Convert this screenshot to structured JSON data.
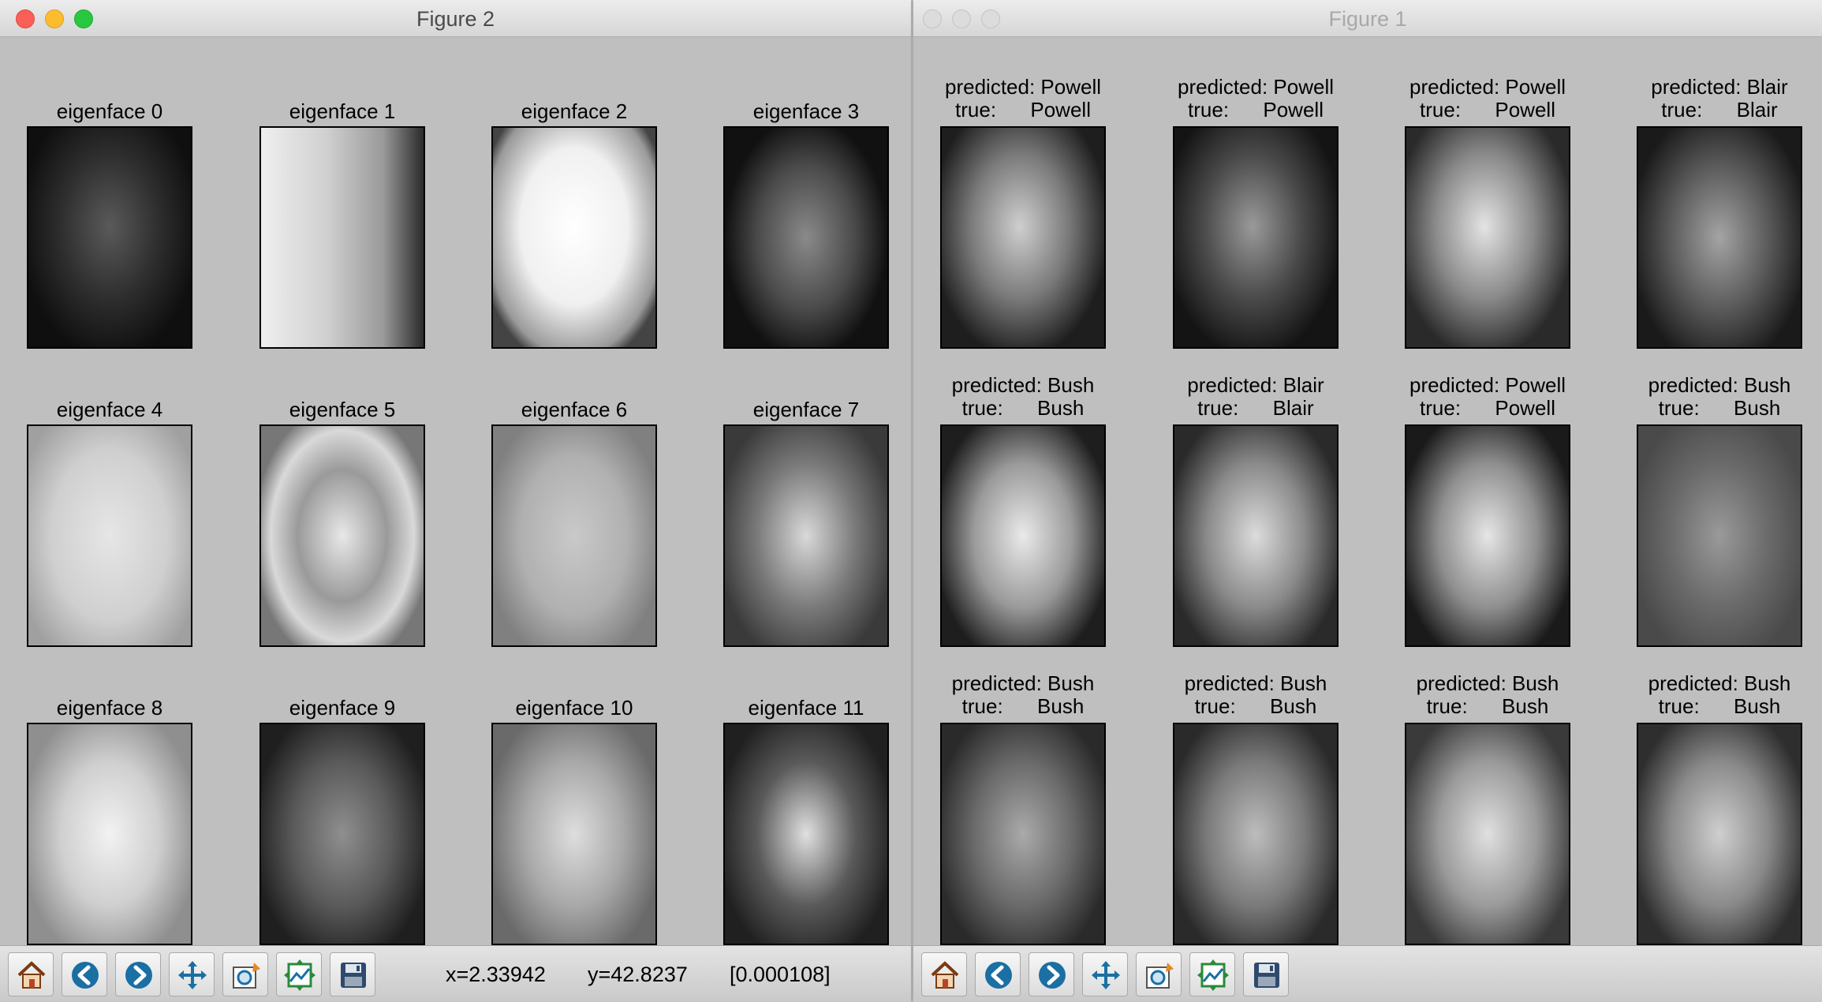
{
  "windows": {
    "figure2": {
      "title": "Figure 2",
      "panels": [
        "eigenface 0",
        "eigenface 1",
        "eigenface 2",
        "eigenface 3",
        "eigenface 4",
        "eigenface 5",
        "eigenface 6",
        "eigenface 7",
        "eigenface 8",
        "eigenface 9",
        "eigenface 10",
        "eigenface 11"
      ],
      "status": {
        "x": "x=2.33942",
        "y": "y=42.8237",
        "value": "[0.000108]"
      }
    },
    "figure1": {
      "title": "Figure 1",
      "panels": [
        "predicted: Powell\ntrue:      Powell",
        "predicted: Powell\ntrue:      Powell",
        "predicted: Powell\ntrue:      Powell",
        "predicted: Blair\ntrue:      Blair",
        "predicted: Bush\ntrue:      Bush",
        "predicted: Blair\ntrue:      Blair",
        "predicted: Powell\ntrue:      Powell",
        "predicted: Bush\ntrue:      Bush",
        "predicted: Bush\ntrue:      Bush",
        "predicted: Bush\ntrue:      Bush",
        "predicted: Bush\ntrue:      Bush",
        "predicted: Bush\ntrue:      Bush"
      ]
    }
  },
  "toolbar_icons": [
    "home-icon",
    "back-icon",
    "forward-icon",
    "pan-icon",
    "zoom-rect-icon",
    "subplots-icon",
    "save-icon"
  ],
  "colors": {
    "figure_bg": "#bfbfbf",
    "close": "#fc5f57",
    "minimize": "#fdbc2e",
    "maximize": "#28c840",
    "tool_blue": "#1a6fa3"
  }
}
